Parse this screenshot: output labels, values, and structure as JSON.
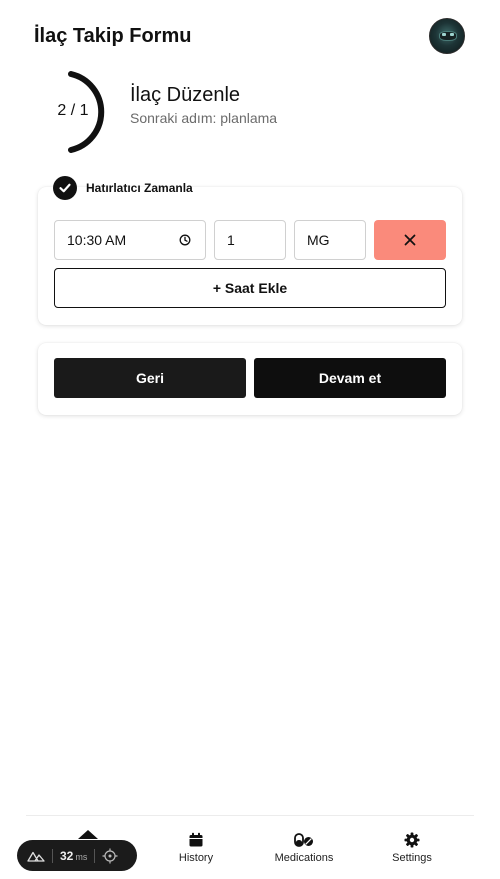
{
  "header": {
    "title": "İlaç Takip Formu"
  },
  "progress": {
    "text": "2 / 1",
    "title": "İlaç Düzenle",
    "subtitle": "Sonraki adım: planlama"
  },
  "reminder": {
    "label": "Hatırlatıcı Zamanla",
    "checked": true,
    "time_value": "10:30 AM",
    "quantity_value": "1",
    "unit_value": "MG",
    "add_time_label": "+ Saat Ekle",
    "remove_color": "#fa8a7b"
  },
  "actions": {
    "back_label": "Geri",
    "next_label": "Devam et"
  },
  "tabbar": {
    "items": [
      {
        "label": "History",
        "icon": "calendar-icon"
      },
      {
        "label": "Medications",
        "icon": "pills-icon"
      },
      {
        "label": "Settings",
        "icon": "gear-icon"
      }
    ]
  },
  "devtools": {
    "ms_value": "32",
    "ms_unit": "ms"
  }
}
